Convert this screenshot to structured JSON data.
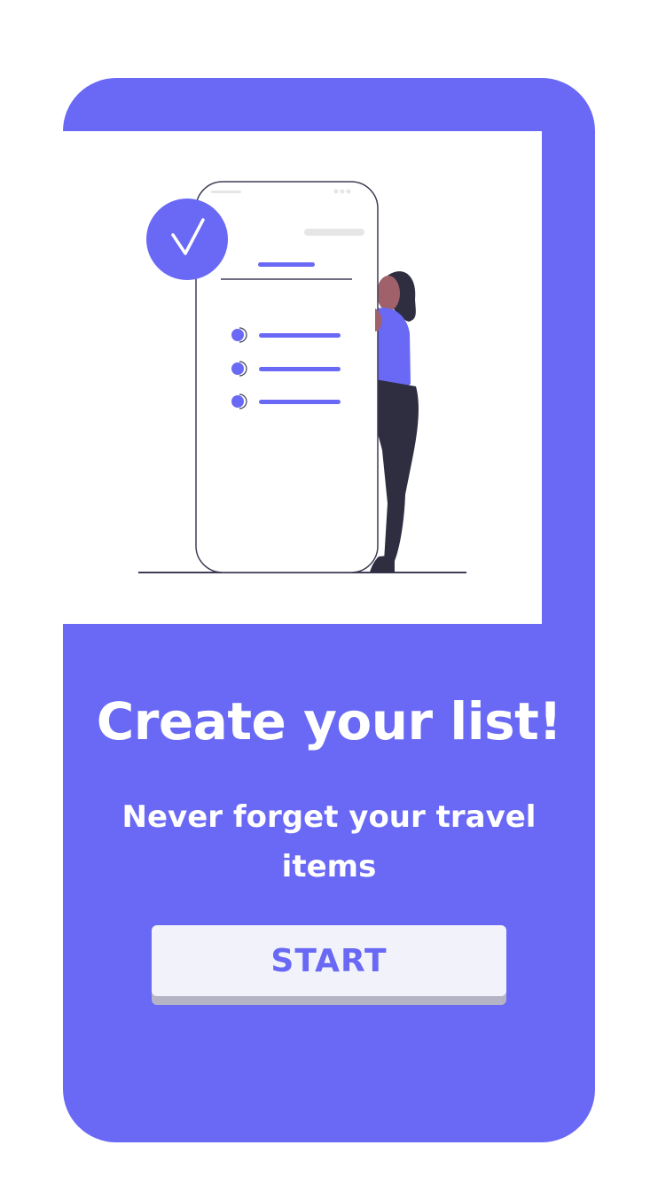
{
  "colors": {
    "accent": "#6969f5",
    "card_background": "#6969f5",
    "button_background": "#f2f3fa",
    "button_shadow": "#b4b4c6",
    "text_on_accent": "#ffffff",
    "person_pants": "#2f2e41",
    "person_skin": "#a0616a"
  },
  "illustration": {
    "icon": "checkmark-icon"
  },
  "onboarding": {
    "title": "Create your list!",
    "subtitle": "Never forget your travel items",
    "start_button_label": "START"
  }
}
